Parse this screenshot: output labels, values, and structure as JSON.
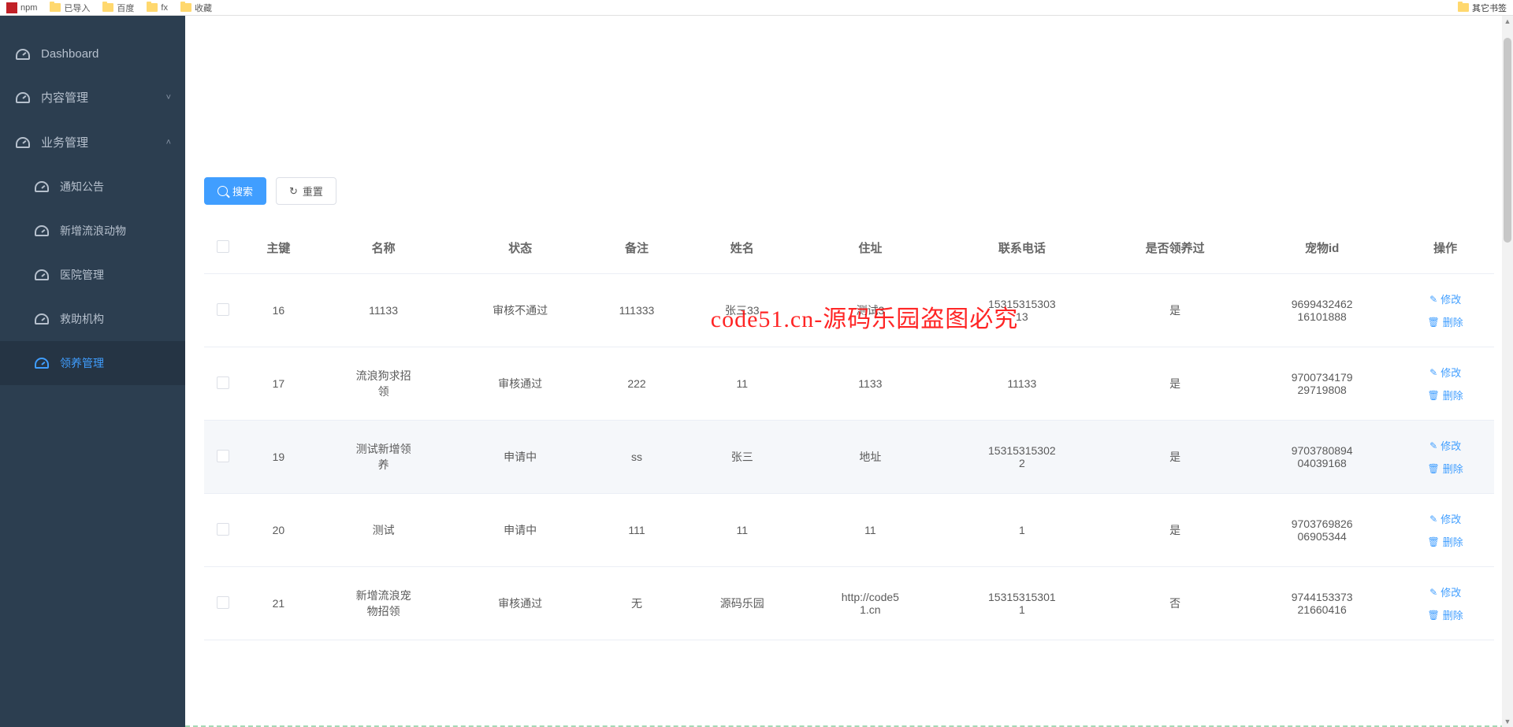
{
  "bookmarks": {
    "left": [
      "npm",
      "已导入",
      "百度",
      "fx",
      "收藏"
    ],
    "right": "其它书签"
  },
  "sidebar": {
    "items": [
      {
        "label": "Dashboard",
        "sub": false,
        "expand": ""
      },
      {
        "label": "内容管理",
        "sub": false,
        "expand": "down"
      },
      {
        "label": "业务管理",
        "sub": false,
        "expand": "up"
      },
      {
        "label": "通知公告",
        "sub": true,
        "expand": ""
      },
      {
        "label": "新增流浪动物",
        "sub": true,
        "expand": ""
      },
      {
        "label": "医院管理",
        "sub": true,
        "expand": ""
      },
      {
        "label": "救助机构",
        "sub": true,
        "expand": ""
      },
      {
        "label": "领养管理",
        "sub": true,
        "expand": "",
        "active": true
      }
    ]
  },
  "buttons": {
    "search": "搜索",
    "reset": "重置"
  },
  "table": {
    "headers": [
      "主键",
      "名称",
      "状态",
      "备注",
      "姓名",
      "住址",
      "联系电话",
      "是否领养过",
      "宠物id",
      "操作"
    ],
    "rows": [
      {
        "id": "16",
        "name": "11133",
        "status": "审核不通过",
        "remark": "111333",
        "person": "张三33",
        "addr": "测试3",
        "phone": "15315315303\n13",
        "adopted": "是",
        "petid": "9699432462\n16101888"
      },
      {
        "id": "17",
        "name": "流浪狗求招\n领",
        "status": "审核通过",
        "remark": "222",
        "person": "11",
        "addr": "1133",
        "phone": "11133",
        "adopted": "是",
        "petid": "9700734179\n29719808"
      },
      {
        "id": "19",
        "name": "测试新增领\n养",
        "status": "申请中",
        "remark": "ss",
        "person": "张三",
        "addr": "地址",
        "phone": "15315315302\n2",
        "adopted": "是",
        "petid": "9703780894\n04039168",
        "hover": true
      },
      {
        "id": "20",
        "name": "测试",
        "status": "申请中",
        "remark": "111",
        "person": "11",
        "addr": "11",
        "phone": "1",
        "adopted": "是",
        "petid": "9703769826\n06905344"
      },
      {
        "id": "21",
        "name": "新增流浪宠\n物招领",
        "status": "审核通过",
        "remark": "无",
        "person": "源码乐园",
        "addr": "http://code5\n1.cn",
        "phone": "15315315301\n1",
        "adopted": "否",
        "petid": "9744153373\n21660416"
      }
    ],
    "actions": {
      "edit": "修改",
      "delete": "删除"
    }
  },
  "watermark": "code51.cn-源码乐园盗图必究"
}
